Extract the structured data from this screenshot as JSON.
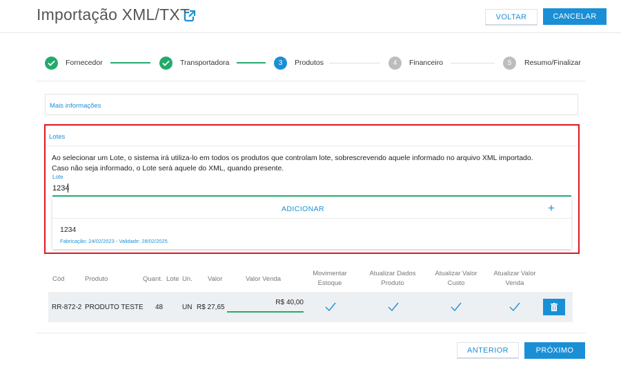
{
  "header": {
    "title": "Importação XML/TXT",
    "voltar_label": "VOLTAR",
    "cancelar_label": "CANCELAR"
  },
  "stepper": {
    "steps": [
      {
        "number": "1",
        "label": "Fornecedor",
        "state": "done"
      },
      {
        "number": "2",
        "label": "Transportadora",
        "state": "done"
      },
      {
        "number": "3",
        "label": "Produtos",
        "state": "active"
      },
      {
        "number": "4",
        "label": "Financeiro",
        "state": "todo"
      },
      {
        "number": "5",
        "label": "Resumo/Finalizar",
        "state": "todo"
      }
    ]
  },
  "mais_info": {
    "title": "Mais informações"
  },
  "lotes": {
    "title": "Lotes",
    "info_line1": "Ao selecionar um Lote, o sistema irá utiliza-lo em todos os produtos que controlam lote, sobrescrevendo aquele informado no arquivo XML importado.",
    "info_line2": "Caso não seja informado, o Lote será aquele do XML, quando presente.",
    "lote_label": "Lote",
    "lote_value": "1234",
    "add_label": "ADICIONAR",
    "add_icon": "+",
    "items": [
      {
        "code": "1234",
        "dates": "Fabricação: 24/02/2023 - Validade: 28/02/2025"
      }
    ]
  },
  "table": {
    "headers": {
      "cod": "Cód",
      "produto": "Produto",
      "quant": "Quant.",
      "lote": "Lote",
      "un": "Un.",
      "valor": "Valor",
      "valor_venda": "Valor Venda",
      "mov_estoque_1": "Movimentar",
      "mov_estoque_2": "Estoque",
      "atu_dados_1": "Atualizar Dados",
      "atu_dados_2": "Produto",
      "atu_custo_1": "Atualizar Valor",
      "atu_custo_2": "Custo",
      "atu_venda_1": "Atualizar Valor",
      "atu_venda_2": "Venda"
    },
    "rows": [
      {
        "cod": "RR-872-2",
        "produto": "PRODUTO TESTE",
        "quant": "48",
        "lote": "",
        "un": "UN",
        "valor": "R$ 27,65",
        "valor_venda": "R$ 40,00"
      }
    ]
  },
  "footer": {
    "anterior_label": "ANTERIOR",
    "proximo_label": "PRÓXIMO"
  },
  "colors": {
    "primary": "#1a8fd6",
    "success": "#26a96c",
    "highlight": "#e2141c",
    "inactive": "#bdbdbd"
  },
  "icons": {
    "external": "external-link-icon",
    "check": "check-icon",
    "trash": "trash-icon",
    "plus": "plus-icon"
  }
}
